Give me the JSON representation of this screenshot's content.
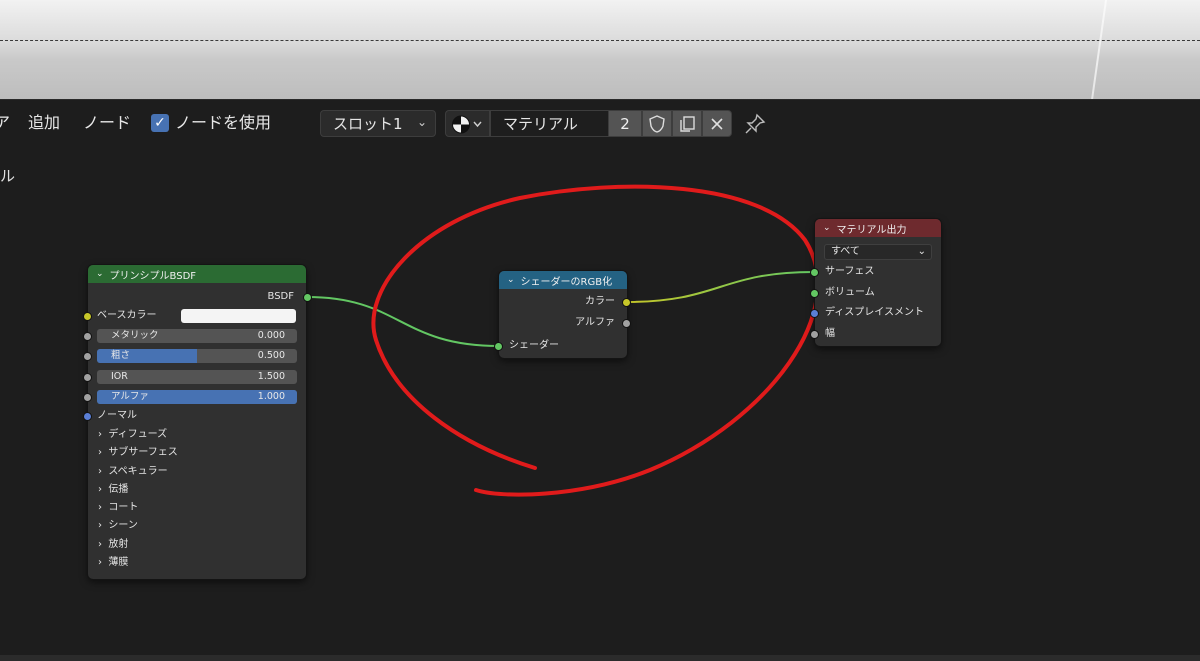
{
  "header": {
    "partial_select": "ア",
    "menu_add": "追加",
    "menu_node": "ノード",
    "use_nodes_label": "ノードを使用",
    "use_nodes_checked": true,
    "slot_label": "スロット1",
    "material_name": "マテリアル",
    "material_users": "2"
  },
  "side_label": "ル",
  "nodes": {
    "bsdf": {
      "title": "プリンシプルBSDF",
      "header_color": "#2b6b33",
      "output": "BSDF",
      "base_color_label": "ベースカラー",
      "base_color_value": "#f4f4f4",
      "fields": [
        {
          "label": "メタリック",
          "value": "0.000",
          "fraction": 0.0
        },
        {
          "label": "粗さ",
          "value": "0.500",
          "fraction": 0.5
        },
        {
          "label": "IOR",
          "value": "1.500",
          "fraction": 0.0
        },
        {
          "label": "アルファ",
          "value": "1.000",
          "fraction": 1.0
        }
      ],
      "normal_label": "ノーマル",
      "panels": [
        "ディフューズ",
        "サブサーフェス",
        "スペキュラー",
        "伝播",
        "コート",
        "シーン",
        "放射",
        "薄膜"
      ]
    },
    "to_rgb": {
      "title": "シェーダーのRGB化",
      "header_color": "#246283",
      "out_color": "カラー",
      "out_alpha": "アルファ",
      "in_shader": "シェーダー"
    },
    "output": {
      "title": "マテリアル出力",
      "header_color": "#6e2a2e",
      "target": "すべて",
      "in_surface": "サーフェス",
      "in_volume": "ボリューム",
      "in_displacement": "ディスプレイスメント",
      "in_thickness": "幅"
    }
  },
  "annotation_color": "#e01b1b"
}
